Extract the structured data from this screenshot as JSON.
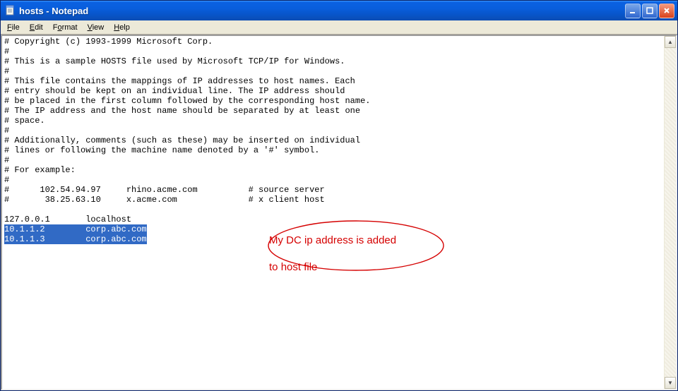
{
  "window": {
    "title": "hosts - Notepad",
    "icon": "notepad-icon"
  },
  "menu": {
    "file": "File",
    "edit": "Edit",
    "format": "Format",
    "view": "View",
    "help": "Help"
  },
  "text": {
    "l01": "# Copyright (c) 1993-1999 Microsoft Corp.",
    "l02": "#",
    "l03": "# This is a sample HOSTS file used by Microsoft TCP/IP for Windows.",
    "l04": "#",
    "l05": "# This file contains the mappings of IP addresses to host names. Each",
    "l06": "# entry should be kept on an individual line. The IP address should",
    "l07": "# be placed in the first column followed by the corresponding host name.",
    "l08": "# The IP address and the host name should be separated by at least one",
    "l09": "# space.",
    "l10": "#",
    "l11": "# Additionally, comments (such as these) may be inserted on individual",
    "l12": "# lines or following the machine name denoted by a '#' symbol.",
    "l13": "#",
    "l14": "# For example:",
    "l15": "#",
    "l16": "#      102.54.94.97     rhino.acme.com          # source server",
    "l17": "#       38.25.63.10     x.acme.com              # x client host",
    "l18": "",
    "l19": "127.0.0.1       localhost",
    "l20": "10.1.1.2        corp.abc.com",
    "l21": "10.1.1.3        corp.abc.com"
  },
  "annotation": {
    "line1": "My DC ip address is added",
    "line2": "to host file"
  },
  "colors": {
    "titlebar": "#0a61e2",
    "selection": "#316ac5",
    "annotation": "#d50000"
  }
}
